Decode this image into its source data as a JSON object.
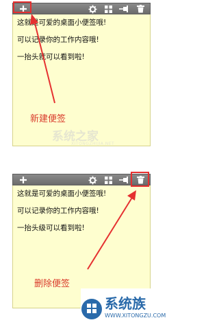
{
  "top_note": {
    "lines": [
      "这就是可爱的桌面小便签哦!",
      "可以记录你的工作内容哦!",
      "一抬头就可以看到啦!"
    ]
  },
  "bottom_note": {
    "lines": [
      "这就是可爱的桌面小便签哦!",
      "可以记录你的工作内容哦!",
      "一抬头级可以看到啦!"
    ]
  },
  "annotations": {
    "new_note": "新建便签",
    "delete_note": "删除便签"
  },
  "watermarks": {
    "top_cn": "系统之家",
    "top_en": "XITONGZHIJIA.NET",
    "bottom_cn": "系统族",
    "bottom_en": "WWW.XITONGZU.COM"
  },
  "colors": {
    "note_background": "#fefecf",
    "toolbar": "#7a7a7a",
    "highlight": "#e53030",
    "annotation_text": "#d93a2b"
  },
  "icons": {
    "add": "plus-icon",
    "settings": "gear-icon",
    "list": "grid-icon",
    "pin": "pin-icon",
    "delete": "trash-icon"
  }
}
